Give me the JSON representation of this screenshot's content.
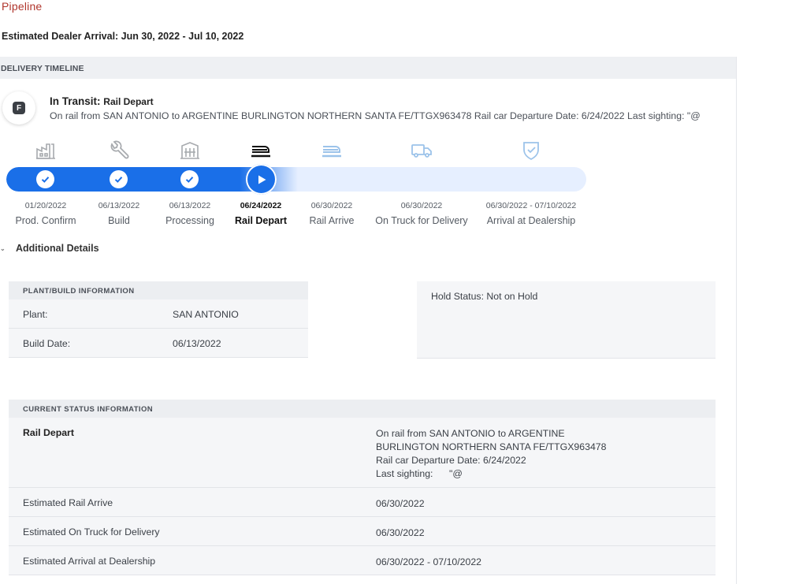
{
  "page": {
    "title": "Pipeline",
    "estimated_arrival": "Estimated Dealer Arrival: Jun 30, 2022 - Jul 10, 2022"
  },
  "timeline": {
    "header": "DELIVERY TIMELINE",
    "brand_letter": "F",
    "status_label": "In Transit:",
    "status_value": "Rail Depart",
    "description": "On rail from SAN ANTONIO to ARGENTINE BURLINGTON NORTHERN SANTA FE/TTGX963478 Rail car Departure Date: 6/24/2022 Last sighting: \"@",
    "progress_fraction": 0.5,
    "stages": [
      {
        "date": "01/20/2022",
        "name": "Prod. Confirm",
        "state": "done",
        "icon": "factory-icon"
      },
      {
        "date": "06/13/2022",
        "name": "Build",
        "state": "done",
        "icon": "wrench-icon"
      },
      {
        "date": "06/13/2022",
        "name": "Processing",
        "state": "done",
        "icon": "processing-icon"
      },
      {
        "date": "06/24/2022",
        "name": "Rail Depart",
        "state": "current",
        "icon": "rail-depart-icon"
      },
      {
        "date": "06/30/2022",
        "name": "Rail Arrive",
        "state": "pending",
        "icon": "rail-arrive-icon"
      },
      {
        "date": "06/30/2022",
        "name": "On Truck for Delivery",
        "state": "pending",
        "icon": "truck-icon"
      },
      {
        "date": "06/30/2022 - 07/10/2022",
        "name": "Arrival at Dealership",
        "state": "pending",
        "icon": "shield-check-icon"
      }
    ]
  },
  "details": {
    "toggle_label": "Additional Details",
    "plant_card": {
      "header": "PLANT/BUILD INFORMATION",
      "rows": [
        {
          "label": "Plant:",
          "value": "SAN ANTONIO"
        },
        {
          "label": "Build Date:",
          "value": "06/13/2022"
        }
      ]
    },
    "hold_status": "Hold Status: Not on Hold",
    "status_card": {
      "header": "CURRENT STATUS INFORMATION",
      "current": {
        "label": "Rail Depart",
        "lines": [
          "On rail from SAN ANTONIO to ARGENTINE",
          "BURLINGTON NORTHERN SANTA FE/TTGX963478",
          "Rail car Departure Date: 6/24/2022",
          "Last sighting:      \"@"
        ]
      },
      "rows": [
        {
          "label": "Estimated Rail Arrive",
          "value": "06/30/2022"
        },
        {
          "label": "Estimated On Truck for Delivery",
          "value": "06/30/2022"
        },
        {
          "label": "Estimated Arrival at Dealership",
          "value": "06/30/2022 - 07/10/2022"
        }
      ]
    }
  },
  "colors": {
    "accent": "#1a6fe8",
    "title_red": "#b0352c",
    "done_icon": "#a7aaae",
    "pending_icon": "#9cc3ea"
  }
}
